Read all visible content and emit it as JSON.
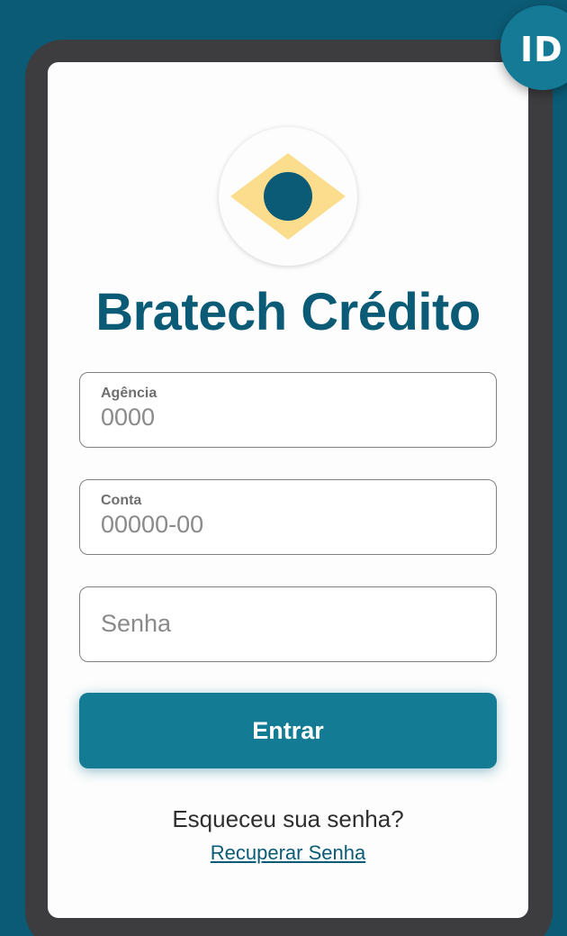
{
  "badge": {
    "text": "ID"
  },
  "brand": {
    "title": "Bratech Crédito",
    "logo_icon": "diamond-circle-logo-icon"
  },
  "form": {
    "agencia": {
      "label": "Agência",
      "value": "0000"
    },
    "conta": {
      "label": "Conta",
      "value": "00000-00"
    },
    "senha": {
      "placeholder": "Senha"
    }
  },
  "actions": {
    "enter_label": "Entrar",
    "forgot_text": "Esqueceu sua senha?",
    "recover_link": "Recuperar Senha"
  },
  "colors": {
    "background": "#0b5b76",
    "accent": "#147b95",
    "logo_yellow": "#fcdd8e",
    "phone_frame": "#3d3d3f"
  }
}
